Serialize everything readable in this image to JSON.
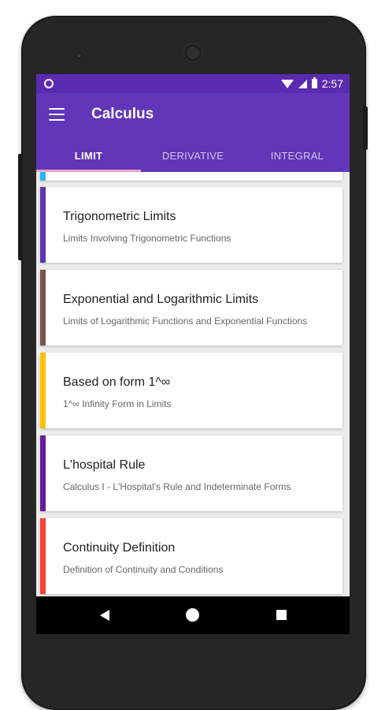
{
  "status_bar": {
    "time": "2:57",
    "icons": [
      "notification-circle-icon",
      "wifi-icon",
      "signal-icon",
      "battery-icon"
    ]
  },
  "app_bar": {
    "title": "Calculus",
    "menu_icon": "hamburger-menu-icon",
    "color": "#6236b9"
  },
  "tabs": [
    {
      "label": "LIMIT",
      "selected": true
    },
    {
      "label": "DERIVATIVE",
      "selected": false
    },
    {
      "label": "INTEGRAL",
      "selected": false
    }
  ],
  "list": {
    "items": [
      {
        "title": "",
        "subtitle": "",
        "color": "#29b6f6"
      },
      {
        "title": "Trigonometric Limits",
        "subtitle": "Limits Involving Trigonometric Functions",
        "color": "#5e35b1"
      },
      {
        "title": "Exponential and Logarithmic Limits",
        "subtitle": "Limits of Logarithmic Functions and Exponential Functions",
        "color": "#795548"
      },
      {
        "title": "Based on form 1^∞",
        "subtitle": "1^∞ Infinity Form in Limits",
        "color": "#ffc107"
      },
      {
        "title": "L'hospital Rule",
        "subtitle": "Calculus I - L'Hospital's Rule and Indeterminate Forms",
        "color": "#6a1b9a"
      },
      {
        "title": "Continuity Definition",
        "subtitle": "Definition of Continuity and Conditions",
        "color": "#f44336"
      }
    ]
  },
  "nav_bar": {
    "icons": [
      "back-icon",
      "home-icon",
      "recent-apps-icon"
    ]
  }
}
